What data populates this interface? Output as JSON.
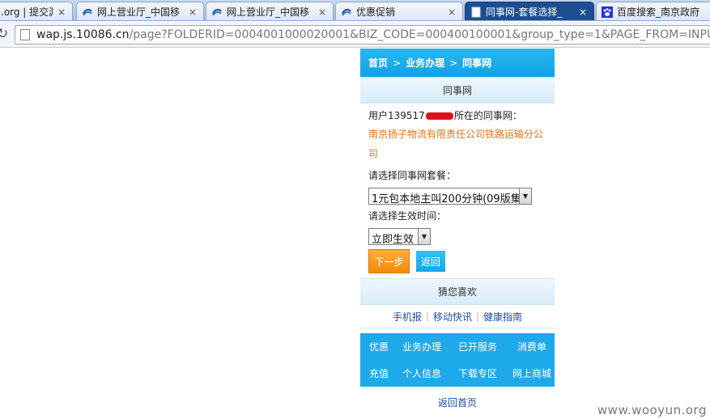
{
  "browser": {
    "tabs": [
      {
        "title": ".org | 提交漏",
        "icon": "none",
        "active": false
      },
      {
        "title": "网上营业厅_中国移",
        "icon": "globe-icon",
        "active": false
      },
      {
        "title": "网上营业厅_中国移",
        "icon": "globe-icon",
        "active": false
      },
      {
        "title": "优惠促销",
        "icon": "globe-icon",
        "active": false
      },
      {
        "title": "同事网-套餐选择_",
        "icon": "page-icon",
        "active": true
      },
      {
        "title": "百度搜索_南京政府",
        "icon": "baidu-paw-icon",
        "active": false
      }
    ],
    "close_glyph": "×",
    "url_host": "wap.js.10086.cn",
    "url_path": "/page?FOLDERID=0004001000020001&BIZ_CODE=000400100001&group_type=1&PAGE_FROM=INPUT"
  },
  "page": {
    "breadcrumb": {
      "home": "首页",
      "sep": ">",
      "business": "业务办理",
      "current": "同事网"
    },
    "section_title": "同事网",
    "user_prefix": "用户139517",
    "user_suffix": "所在的同事网：",
    "company": "南京扬子物流有限责任公司铁路运输分公司",
    "package_label": "请选择同事网套餐：",
    "package_value": "1元包本地主叫200分钟(09版集",
    "time_label": "请选择生效时间：",
    "time_value": "立即生效",
    "next_button": "下一步",
    "back_button": "返回",
    "recommend_title": "猜您喜欢",
    "recommend_links": [
      "手机报",
      "移动快讯",
      "健康指南"
    ],
    "link_divider": "|",
    "nav_grid": [
      "优惠",
      "业务办理",
      "已开服务",
      "消费单",
      "充值",
      "个人信息",
      "下载专区",
      "网上商城"
    ],
    "home_link": "返回首页"
  },
  "watermark": "www.wooyun.org",
  "colors": {
    "header_blue": "#0ea2e3",
    "orange": "#f28c08",
    "company_orange": "#e2731b",
    "redaction": "#e0101a"
  }
}
